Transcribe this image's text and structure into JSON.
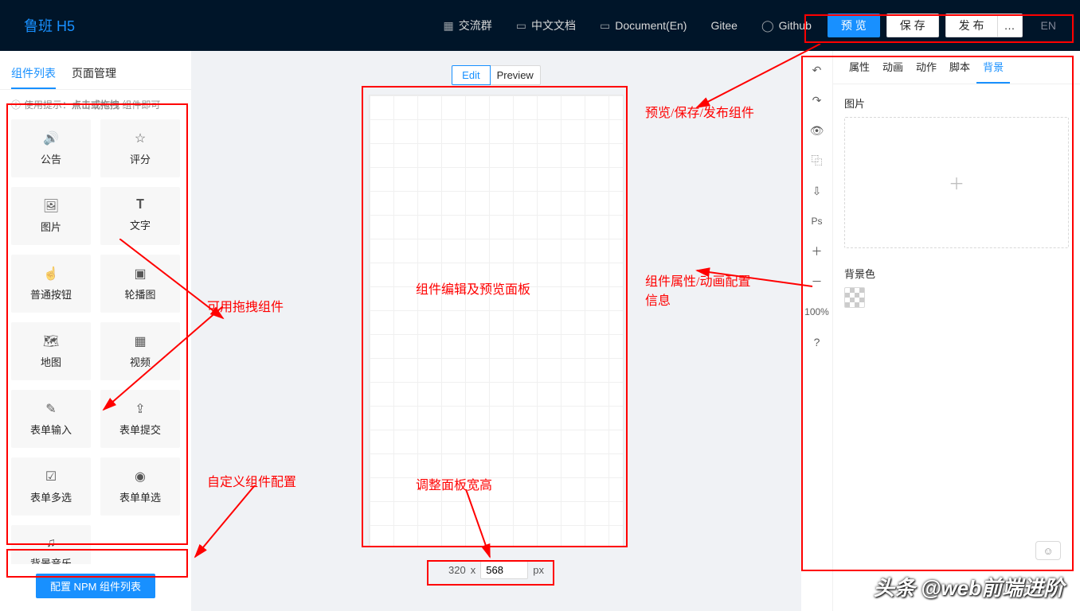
{
  "header": {
    "logo": "鲁班 H5",
    "nav": [
      {
        "label": "交流群"
      },
      {
        "label": "中文文档"
      },
      {
        "label": "Document(En)"
      },
      {
        "label": "Gitee"
      },
      {
        "label": "Github"
      }
    ],
    "preview": "预 览",
    "save": "保 存",
    "publish": "发 布",
    "more": "…",
    "lang": "EN"
  },
  "leftPanel": {
    "tabs": [
      "组件列表",
      "页面管理"
    ],
    "hint_prefix": "使用提示：",
    "hint_bold": "点击或拖拽",
    "hint_suffix": " 组件即可",
    "components": [
      {
        "icon": "🔊",
        "label": "公告"
      },
      {
        "icon": "☆",
        "label": "评分"
      },
      {
        "icon": "🖼",
        "label": "图片"
      },
      {
        "icon": "𝐓",
        "label": "文字"
      },
      {
        "icon": "☝",
        "label": "普通按钮"
      },
      {
        "icon": "▣",
        "label": "轮播图"
      },
      {
        "icon": "🗺",
        "label": "地图"
      },
      {
        "icon": "▦",
        "label": "视频"
      },
      {
        "icon": "✎",
        "label": "表单输入"
      },
      {
        "icon": "⇪",
        "label": "表单提交"
      },
      {
        "icon": "☑",
        "label": "表单多选"
      },
      {
        "icon": "◉",
        "label": "表单单选"
      },
      {
        "icon": "♫",
        "label": "背景音乐"
      }
    ],
    "npm_btn": "配置 NPM 组件列表"
  },
  "canvas": {
    "edit": "Edit",
    "preview": "Preview",
    "width": "320",
    "height": "568",
    "x": "x",
    "px": "px"
  },
  "toolbar": {
    "zoom": "100%"
  },
  "rightPanel": {
    "tabs": [
      "属性",
      "动画",
      "动作",
      "脚本",
      "背景"
    ],
    "image_label": "图片",
    "bg_color_label": "背景色"
  },
  "annot": {
    "a1": "可用拖拽组件",
    "a2": "自定义组件配置",
    "a3": "组件编辑及预览面板",
    "a4": "调整面板宽高",
    "a5": "预览/保存/发布组件",
    "a6": "组件属性/动画配置信息"
  },
  "watermark": "头条 @web前端进阶"
}
